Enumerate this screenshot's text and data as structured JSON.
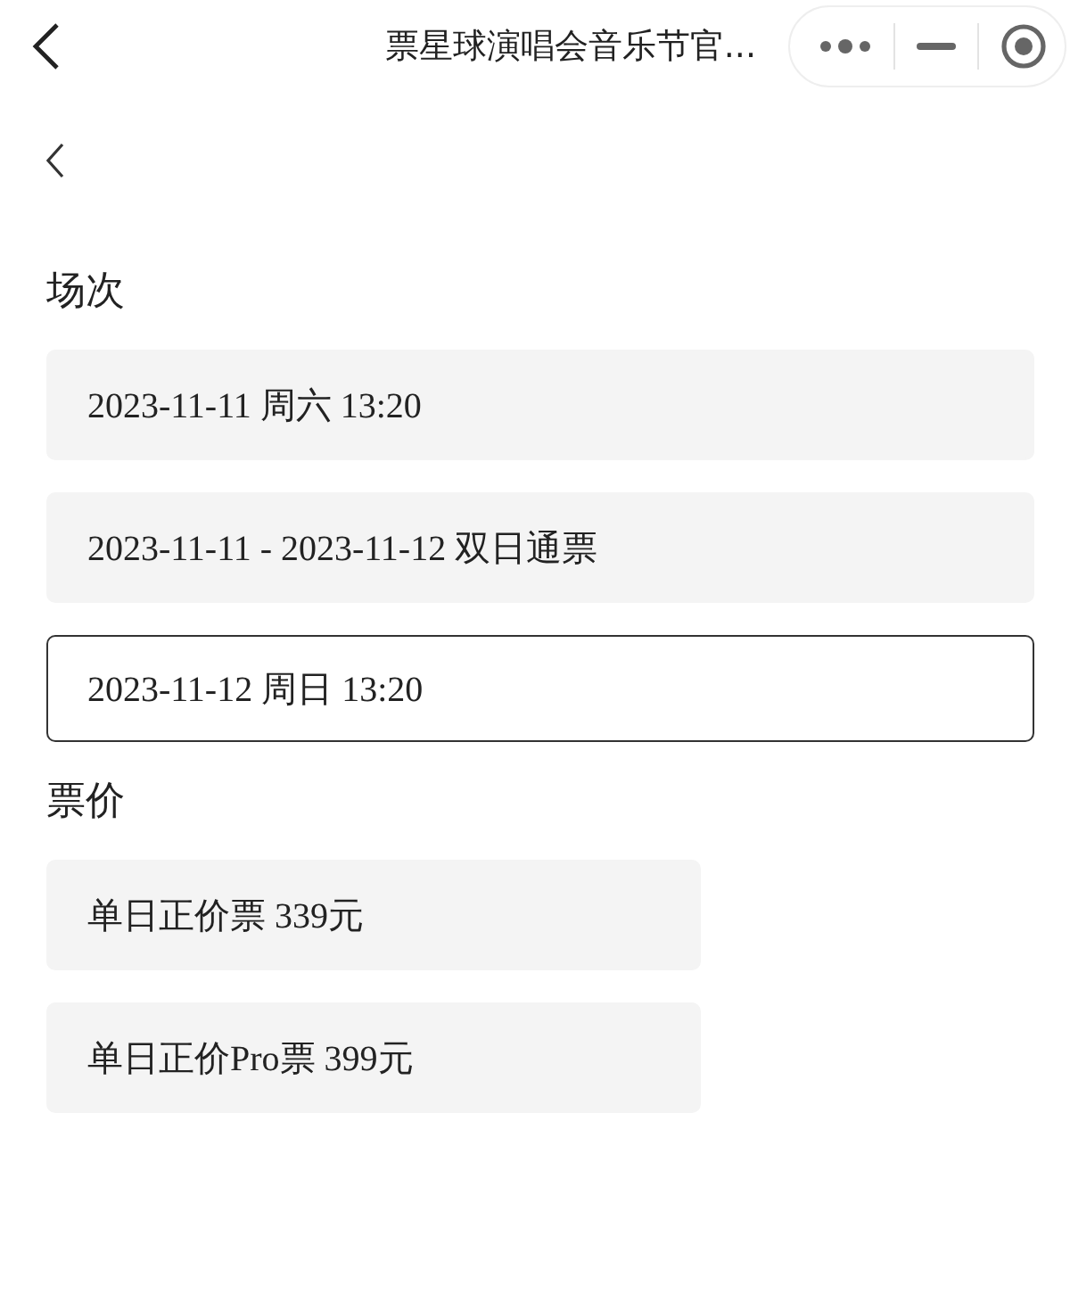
{
  "nav_bar": {
    "title": "票星球演唱会音乐节官..."
  },
  "sections": [
    {
      "heading": "场次",
      "kind": "wide",
      "options": [
        {
          "label": "2023-11-11 周六 13:20",
          "selected": false
        },
        {
          "label": "2023-11-11 - 2023-11-12 双日通票",
          "selected": false
        },
        {
          "label": "2023-11-12 周日 13:20",
          "selected": true
        }
      ]
    },
    {
      "heading": "票价",
      "kind": "narrow",
      "options": [
        {
          "label": "单日正价票 339元",
          "selected": false
        },
        {
          "label": "单日正价Pro票 399元",
          "selected": false
        }
      ]
    }
  ]
}
